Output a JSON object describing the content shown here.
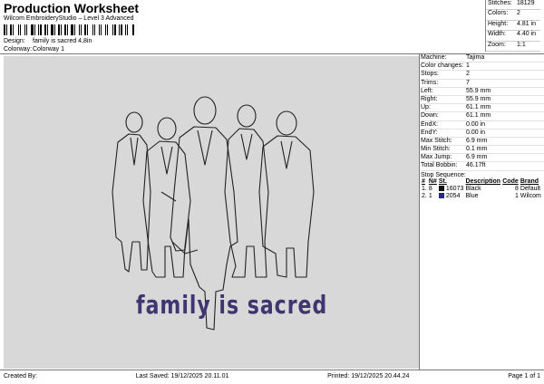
{
  "header": {
    "title": "Production Worksheet",
    "subtitle": "Wilcom EmbroideryStudio – Level 3 Advanced",
    "design_label": "Design:",
    "design_value": "family is sacred 4,8in",
    "colorway_label": "Colorway:",
    "colorway_value": "Colorway 1"
  },
  "summary": [
    {
      "label": "Stitches:",
      "value": "18129"
    },
    {
      "label": "Colors:",
      "value": "2"
    },
    {
      "label": "Height:",
      "value": "4.81 in"
    },
    {
      "label": "Width:",
      "value": "4.40 in"
    },
    {
      "label": "Zoom:",
      "value": "1:1"
    }
  ],
  "machine_info": [
    {
      "label": "Machine:",
      "value": "Tajima"
    },
    {
      "label": "Color changes:",
      "value": "1"
    },
    {
      "label": "Stops:",
      "value": "2"
    },
    {
      "label": "Trims:",
      "value": "7"
    },
    {
      "label": "Left:",
      "value": "55.9 mm"
    },
    {
      "label": "Right:",
      "value": "55.9 mm"
    },
    {
      "label": "Up:",
      "value": "61.1 mm"
    },
    {
      "label": "Down:",
      "value": "61.1 mm"
    },
    {
      "label": "EndX:",
      "value": "0.00 in"
    },
    {
      "label": "EndY:",
      "value": "0.00 in"
    },
    {
      "label": "Max Stitch:",
      "value": "6.9 mm"
    },
    {
      "label": "Min Stitch:",
      "value": "0.1 mm"
    },
    {
      "label": "Max Jump:",
      "value": "6.9 mm"
    },
    {
      "label": "Total Bobbin:",
      "value": "46.17ft"
    }
  ],
  "stop_sequence": {
    "title": "Stop Sequence:",
    "headers": [
      "#",
      "N#",
      "St.",
      "Description",
      "Code",
      "Brand"
    ],
    "rows": [
      {
        "num": "1.",
        "n": "8",
        "st": "16073",
        "desc": "Black",
        "code": "8",
        "brand": "Default",
        "color": "#111111"
      },
      {
        "num": "2.",
        "n": "1",
        "st": "2054",
        "desc": "Blue",
        "code": "1",
        "brand": "Wilcom",
        "color": "#2a2a7a"
      }
    ]
  },
  "design_preview": {
    "caption": "family is sacred",
    "caption_color": "#3f3570",
    "background": "#d8d8d8"
  },
  "footer": {
    "created_by": "Created By:",
    "last_saved": "Last Saved: 19/12/2025 20.11.01",
    "printed": "Printed: 19/12/2025 20.44.24",
    "page": "Page 1 of 1"
  }
}
